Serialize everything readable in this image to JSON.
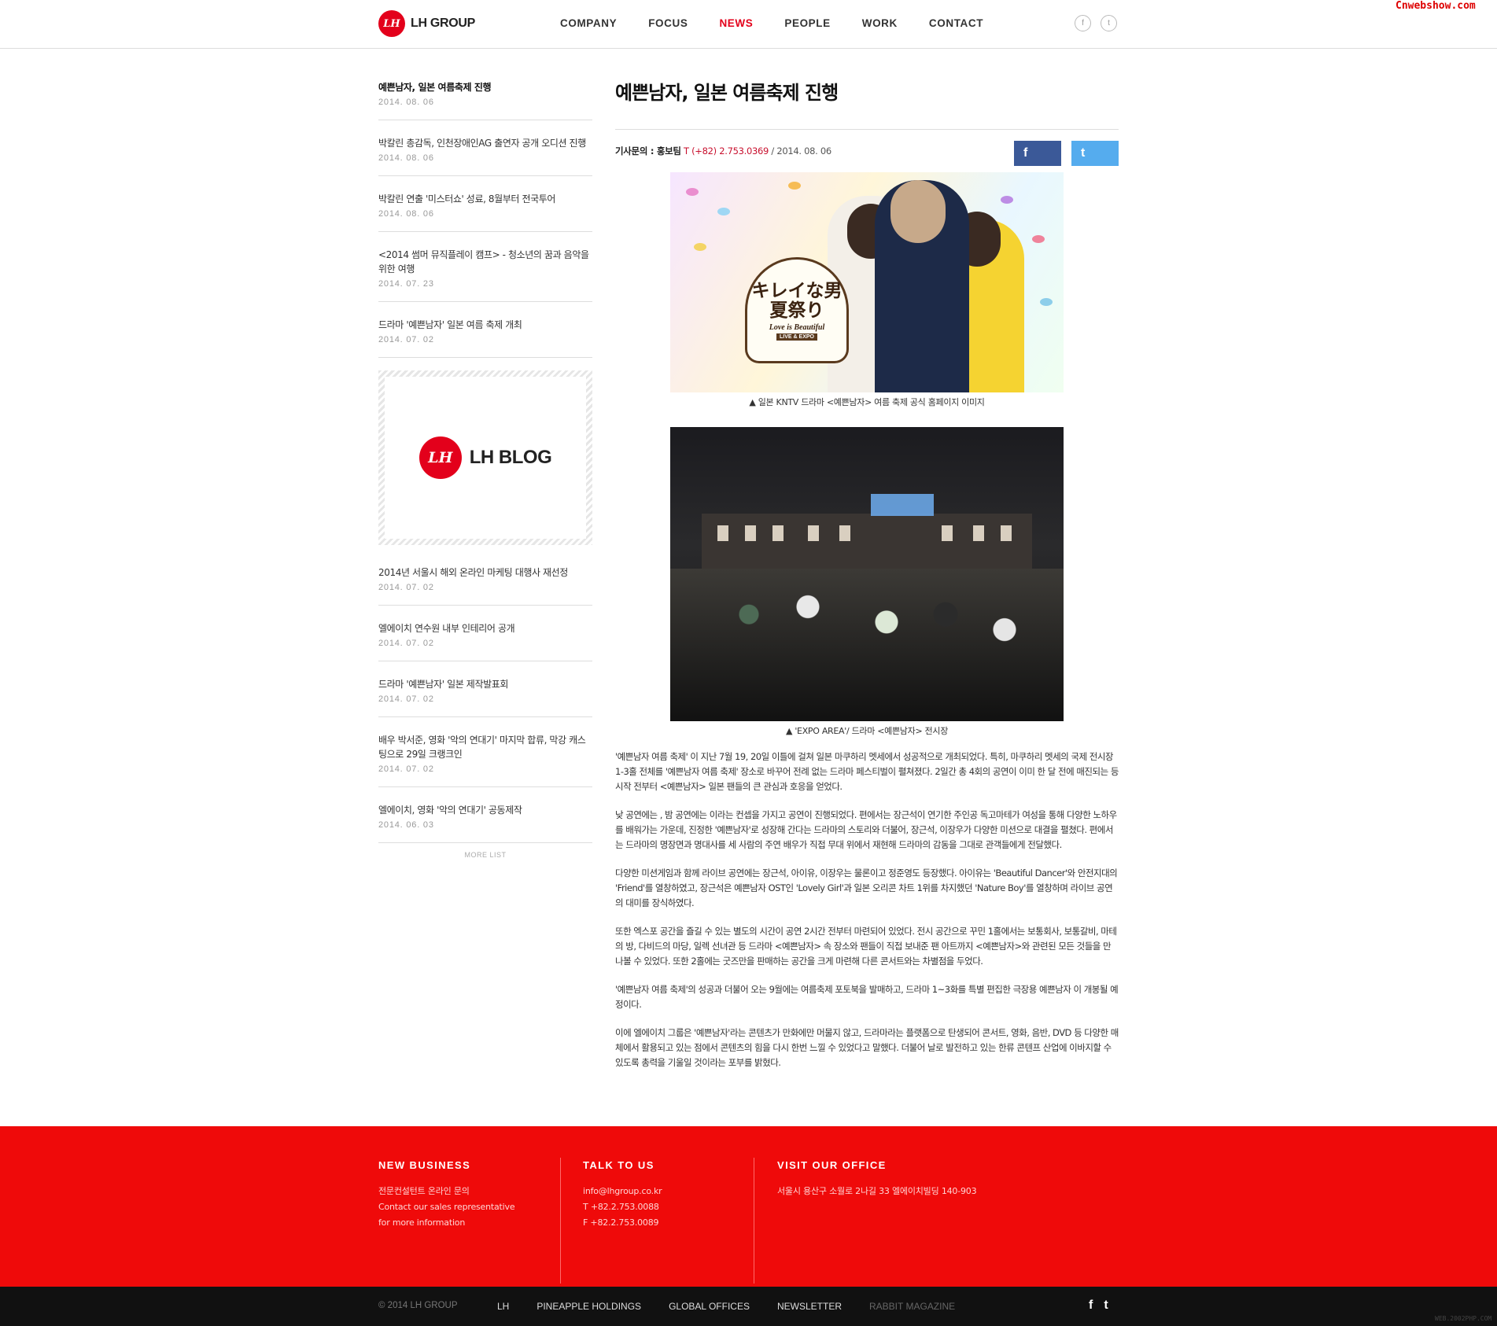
{
  "watermark": "Cnwebshow.com",
  "header": {
    "logo_mark": "LH",
    "logo_text": "LH GROUP",
    "nav": [
      "COMPANY",
      "FOCUS",
      "NEWS",
      "PEOPLE",
      "WORK",
      "CONTACT"
    ],
    "active_nav": "NEWS",
    "social": [
      "f",
      "t"
    ]
  },
  "sidebar": {
    "items_top": [
      {
        "title": "예쁜남자, 일본 여름축제 진행",
        "date": "2014. 08. 06"
      },
      {
        "title": "박칼린 총감독, 인천장애인AG 출연자 공개 오디션 진행",
        "date": "2014. 08. 06"
      },
      {
        "title": "박칼린 연출 '미스터쇼' 성료, 8월부터 전국투어",
        "date": "2014. 08. 06"
      },
      {
        "title": "<2014 썸머 뮤직플레이 캠프> - 청소년의 꿈과 음악을 위한 여행",
        "date": "2014. 07. 23"
      },
      {
        "title": "드라마 '예쁜남자' 일본 여름 축제 개최",
        "date": "2014. 07. 02"
      }
    ],
    "blog": {
      "mark": "LH",
      "label": "LH BLOG"
    },
    "items_bottom": [
      {
        "title": "2014년 서울시 해외 온라인 마케팅 대행사 재선정",
        "date": "2014. 07. 02"
      },
      {
        "title": "엘에이치 연수원 내부 인테리어 공개",
        "date": "2014. 07. 02"
      },
      {
        "title": "드라마 '예쁜남자' 일본 제작발표회",
        "date": "2014. 07. 02"
      },
      {
        "title": "배우 박서준, 영화 '악의 연대기' 마지막 합류, 막강 캐스팅으로 29일 크랭크인",
        "date": "2014. 07. 02"
      },
      {
        "title": "엘에이치, 영화 '악의 연대기' 공동제작",
        "date": "2014. 06. 03"
      }
    ],
    "more_label": "MORE LIST"
  },
  "article": {
    "title": "예쁜남자, 일본 여름축제 진행",
    "meta_label": "기사문의 : 홍보팀",
    "meta_phone": "T (+82) 2.753.0369",
    "meta_date": "/ 2014. 08. 06",
    "share": {
      "facebook": "f",
      "twitter": "t"
    },
    "image1": {
      "badge_jp": "キレイな男\n夏祭り",
      "badge_en": "Love is Beautiful",
      "badge_sub": "LIVE & EXPO"
    },
    "caption1": "▲ 일본 KNTV 드라마 <예쁜남자> 여름 축제 공식 홈페이지 이미지",
    "caption2": "▲ 'EXPO AREA'/ 드라마 <예쁜남자> 전시장",
    "paragraphs": [
      "'예쁜남자 여름 축제' 이 지난 7월 19, 20일 이틀에 걸쳐 일본 마쿠하리 멧세에서 성공적으로 개최되었다. 특히, 마쿠하리 멧세의 국제 전시장 1-3홀 전체를 '예쁜남자 여름 축제' 장소로 바꾸어 전례 없는 드라마 페스티벌이 펼쳐졌다. 2일간 총 4회의 공연이 이미 한 달 전에 매진되는 등 시작 전부터 <예쁜남자> 일본 팬들의 큰 관심과 호응을 얻었다.",
      "낮 공연에는 , 밤 공연에는 이라는 컨셉을 가지고 공연이 진행되었다. 편에서는 장근석이 연기한 주인공 독고마테가 여성을 통해 다양한 노하우를 배워가는 가운데, 진정한 '예쁜남자'로 성장해 간다는 드라마의 스토리와 더불어, 장근석, 이장우가 다양한 미션으로 대결을 펼쳤다. 편에서는 드라마의 명장면과 명대사를 세 사람의 주연 배우가 직접 무대 위에서 재현해 드라마의 감동을 그대로 관객들에게 전달했다.",
      "다양한 미션게임과 함께 라이브 공연에는 장근석, 아이유, 이장우는 물론이고 정준영도 등장했다. 아이유는 'Beautiful Dancer'와 안전지대의 'Friend'를 열창하였고, 장근석은 예쁜남자 OST인 'Lovely Girl'과 일본 오리콘 차트 1위를 차지했던 'Nature Boy'를 열창하며 라이브 공연의 대미를 장식하였다.",
      "또한 엑스포 공간을 즐길 수 있는 별도의 시간이 공연 2시간 전부터 마련되어 있었다. 전시 공간으로 꾸민 1홀에서는 보통회사, 보통갈비, 마테의 방, 다비드의 마당, 일렉 선녀관 등 드라마 <예쁜남자> 속 장소와 팬들이 직접 보내준 팬 아트까지 <예쁜남자>와 관련된 모든 것들을 만나볼 수 있었다. 또한 2홀에는 굿즈만을 판매하는 공간을 크게 마련해 다른 콘서트와는 차별점을 두었다.",
      "'예쁜남자 여름 축제'의 성공과 더불어 오는 9월에는 여름축제 포토북을 발매하고, 드라마 1~3화를 특별 편집한 극장용 예쁜남자 이 개봉될 예정이다.",
      "이에 엘에이치 그룹은 '예쁜남자'라는 콘텐츠가 만화에만 머물지 않고, 드라마라는 플랫폼으로 탄생되어 콘서트, 영화, 음반, DVD 등 다양한 매체에서 활용되고 있는 점에서 콘텐츠의 힘을 다시 한번 느낄 수 있었다고 말했다. 더불어 날로 발전하고 있는 한류 콘텐프 산업에 이바지할 수 있도록 총력을 기울일 것이라는 포부를 밝혔다."
    ]
  },
  "footer": {
    "cols": [
      {
        "head": "NEW BUSINESS",
        "lines": [
          "전문컨설턴트 온라인 문의",
          "Contact our sales representative",
          "for more information"
        ]
      },
      {
        "head": "TALK TO US",
        "lines": [
          "info@lhgroup.co.kr",
          "T +82.2.753.0088",
          "F +82.2.753.0089"
        ]
      },
      {
        "head": "VISIT OUR OFFICE",
        "lines": [
          "서울시 용산구 소월로 2나길 33 엘에이치빌딩 140-903"
        ]
      }
    ],
    "copyright": "© 2014 LH GROUP",
    "links": [
      "LH",
      "PINEAPPLE HOLDINGS",
      "GLOBAL OFFICES",
      "NEWSLETTER",
      "RABBIT MAGAZINE"
    ],
    "social": [
      "f",
      "t"
    ],
    "tag": "WEB.2002PHP.COM"
  },
  "colors": {
    "brand_red": "#e3001b",
    "footer_red": "#ef0a0a",
    "facebook": "#3b5998",
    "twitter": "#55acee"
  }
}
